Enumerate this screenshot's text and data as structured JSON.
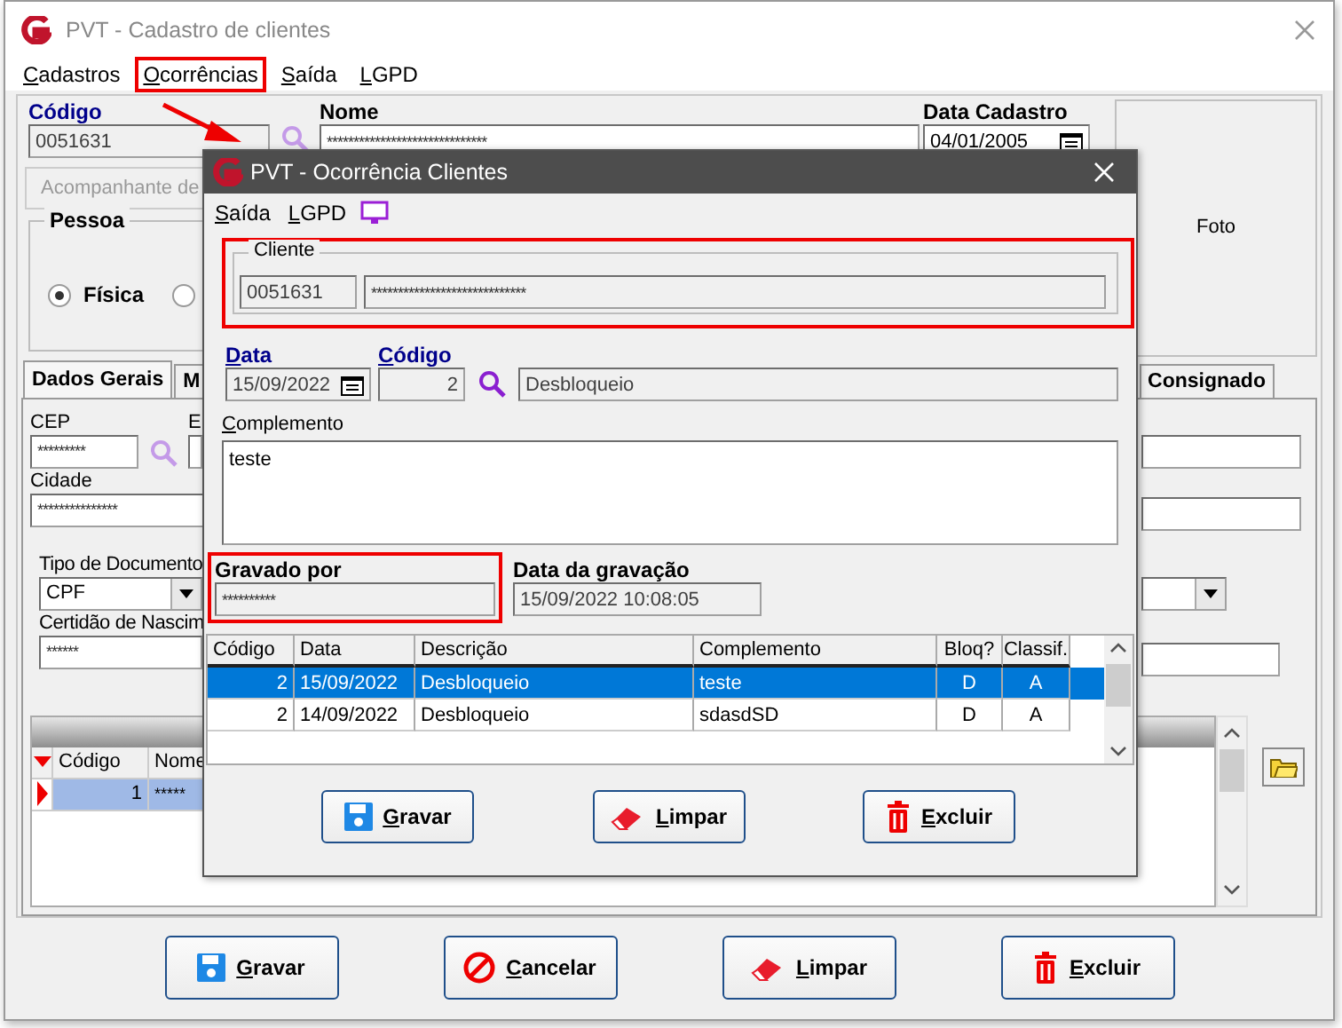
{
  "window": {
    "title": "PVT - Cadastro de clientes"
  },
  "menu": [
    {
      "label": "Cadastros",
      "highlighted": false
    },
    {
      "label": "Ocorrências",
      "highlighted": true
    },
    {
      "label": "Saída",
      "highlighted": false
    },
    {
      "label": "LGPD",
      "highlighted": false
    }
  ],
  "annotation_arrow": true,
  "form": {
    "codigo": {
      "label": "Código",
      "value": "0051631"
    },
    "nome": {
      "label": "Nome",
      "value": "******************************"
    },
    "data_cadastro": {
      "label": "Data Cadastro",
      "value": "04/01/2005"
    },
    "foto": "Foto",
    "acompanhante_button": "Acompanhante de",
    "pessoa": {
      "label": "Pessoa",
      "options": [
        {
          "label": "Física",
          "selected": true
        },
        {
          "selected": false
        }
      ]
    }
  },
  "tabs": [
    {
      "label": "Dados Gerais",
      "selected": true
    },
    {
      "label": "M",
      "selected": false
    },
    {
      "label": "Consignado",
      "selected": false
    }
  ],
  "dados_gerais": {
    "cep": {
      "label": "CEP",
      "value": "*********"
    },
    "e_label": "E",
    "cidade": {
      "label": "Cidade",
      "value": "***************"
    },
    "tipo_documento": {
      "label": "Tipo de Documento",
      "value": "CPF"
    },
    "certidao": {
      "label": "Certidão de Nascim",
      "value": "******"
    }
  },
  "grid": {
    "columns": [
      "Código",
      "Nome"
    ],
    "rows": [
      {
        "codigo": "1",
        "nome": "*****",
        "selected": true
      }
    ]
  },
  "buttons": [
    {
      "label": "Gravar",
      "kind": "save"
    },
    {
      "label": "Cancelar",
      "kind": "cancel"
    },
    {
      "label": "Limpar",
      "kind": "clear"
    },
    {
      "label": "Excluir",
      "kind": "delete"
    }
  ],
  "dialog": {
    "title": "PVT - Ocorrência Clientes",
    "menu": [
      {
        "label": "Saída"
      },
      {
        "label": "LGPD"
      }
    ],
    "cliente": {
      "label": "Cliente",
      "codigo": "0051631",
      "nome": "*****************************",
      "highlighted": true
    },
    "data": {
      "label": "Data",
      "value": "15/09/2022"
    },
    "codigo": {
      "label": "Código",
      "value": "2"
    },
    "descricao": "Desbloqueio",
    "complemento": {
      "label": "Complemento",
      "value": "teste"
    },
    "gravado_por": {
      "label": "Gravado por",
      "value": "**********",
      "highlighted": true
    },
    "data_gravacao": {
      "label": "Data da gravação",
      "value": "15/09/2022 10:08:05"
    },
    "table": {
      "columns": [
        "Código",
        "Data",
        "Descrição",
        "Complemento",
        "Bloq?",
        "Classif."
      ],
      "rows": [
        {
          "cells": [
            "2",
            "15/09/2022",
            "Desbloqueio",
            "teste",
            "D",
            "A"
          ],
          "selected": true
        },
        {
          "cells": [
            "2",
            "14/09/2022",
            "Desbloqueio",
            "sdasdSD",
            "D",
            "A"
          ],
          "selected": false
        }
      ]
    },
    "buttons": [
      {
        "label": "Gravar",
        "kind": "save"
      },
      {
        "label": "Limpar",
        "kind": "clear"
      },
      {
        "label": "Excluir",
        "kind": "delete"
      }
    ]
  }
}
